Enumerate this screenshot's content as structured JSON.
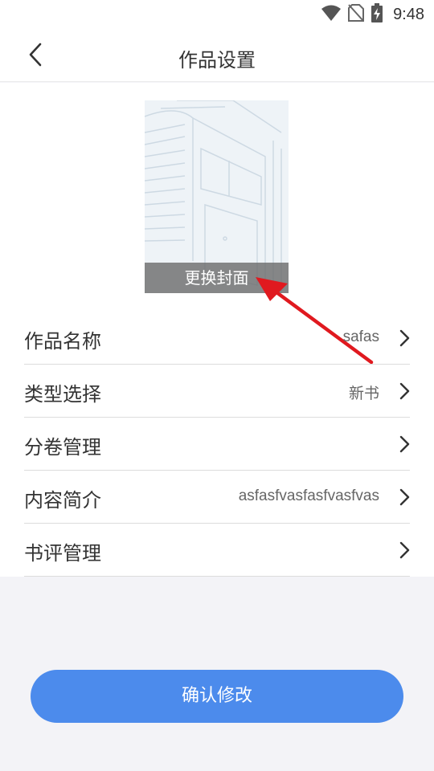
{
  "status_bar": {
    "time": "9:48",
    "icons": [
      "wifi-icon",
      "no-sim-icon",
      "battery-charging-icon"
    ]
  },
  "header": {
    "title": "作品设置",
    "back_icon": "chevron-left-icon"
  },
  "cover": {
    "change_label": "更换封面"
  },
  "settings": {
    "items": [
      {
        "label": "作品名称",
        "value": "safas"
      },
      {
        "label": "类型选择",
        "value": "新书"
      },
      {
        "label": "分卷管理",
        "value": ""
      },
      {
        "label": "内容简介",
        "value": "asfasfvasfasfvasfvas"
      },
      {
        "label": "书评管理",
        "value": ""
      }
    ]
  },
  "actions": {
    "confirm_label": "确认修改"
  },
  "colors": {
    "accent": "#4c8bec",
    "annotation_arrow": "#e0191f",
    "background": "#f3f3f7"
  }
}
